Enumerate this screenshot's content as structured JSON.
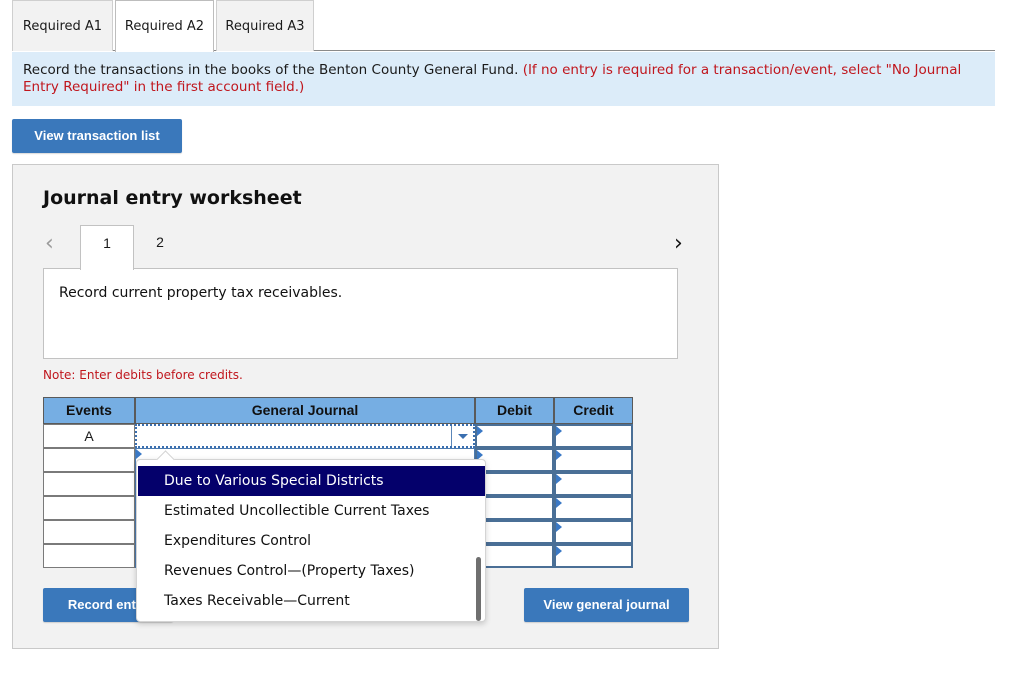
{
  "tabs": [
    {
      "label": "Required A1",
      "active": false
    },
    {
      "label": "Required A2",
      "active": true
    },
    {
      "label": "Required A3",
      "active": false
    }
  ],
  "instructions": {
    "main": "Record the transactions in the books of the Benton County General Fund.",
    "note_red": "(If no entry is required for a transaction/event, select \"No Journal Entry Required\" in the first account field.)"
  },
  "buttons": {
    "view_transaction_list": "View transaction list",
    "record_entry": "Record entry",
    "view_general_journal": "View general journal"
  },
  "worksheet": {
    "title": "Journal entry worksheet",
    "nav_prev_icon": "chevron-left-icon",
    "nav_next_icon": "chevron-right-icon",
    "pages": [
      "1",
      "2"
    ],
    "current_page": "1",
    "description": "Record current property tax receivables.",
    "note": "Note: Enter debits before credits.",
    "table": {
      "headers": {
        "events": "Events",
        "general_journal": "General Journal",
        "debit": "Debit",
        "credit": "Credit"
      },
      "rows": [
        {
          "event": "A",
          "account": "",
          "debit": "",
          "credit": ""
        },
        {
          "event": "",
          "account": "",
          "debit": "",
          "credit": ""
        },
        {
          "event": "",
          "account": "",
          "debit": "",
          "credit": ""
        },
        {
          "event": "",
          "account": "",
          "debit": "",
          "credit": ""
        },
        {
          "event": "",
          "account": "",
          "debit": "",
          "credit": ""
        },
        {
          "event": "",
          "account": "",
          "debit": "",
          "credit": ""
        }
      ]
    }
  },
  "dropdown": {
    "options": [
      "Due to Various Special Districts",
      "Estimated Uncollectible Current Taxes",
      "Expenditures Control",
      "Revenues Control—(Property Taxes)",
      "Taxes Receivable—Current"
    ],
    "highlighted": "Due to Various Special Districts"
  },
  "colors": {
    "accent_button": "#3a78bb",
    "banner_bg": "#dcecf9",
    "note_red": "#c0161d",
    "table_header": "#76aee3",
    "dropdown_highlight": "#04006b"
  }
}
